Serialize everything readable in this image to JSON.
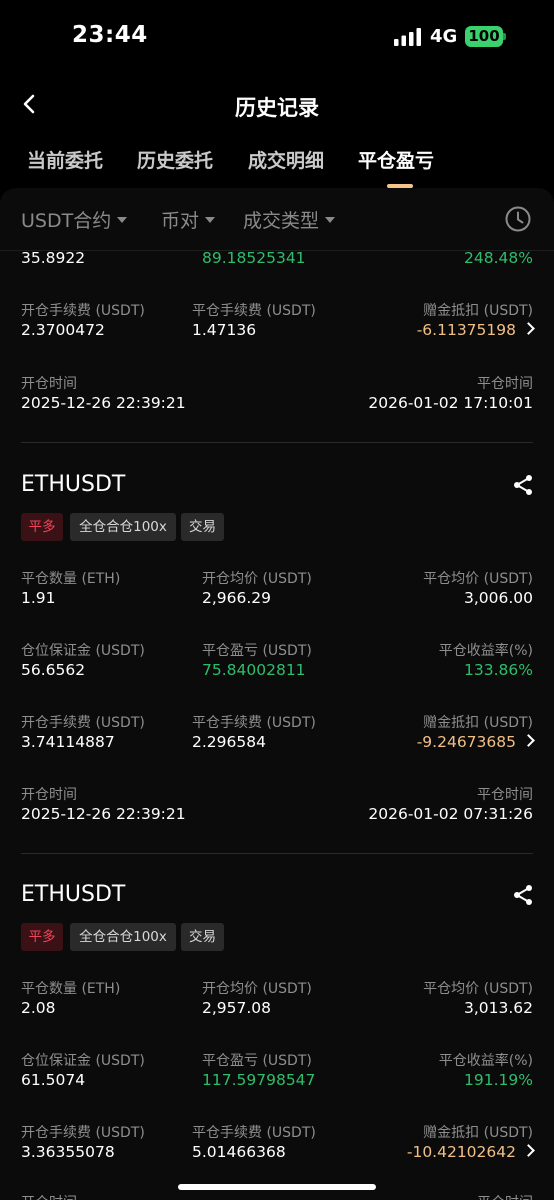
{
  "status": {
    "time": "23:44",
    "network": "4G",
    "battery": "100"
  },
  "nav": {
    "title": "历史记录"
  },
  "tabs": [
    {
      "label": "当前委托",
      "active": false
    },
    {
      "label": "历史委托",
      "active": false
    },
    {
      "label": "成交明细",
      "active": false
    },
    {
      "label": "平仓盈亏",
      "active": true
    }
  ],
  "filters": {
    "contract": "USDT合约",
    "pair": "币对",
    "type": "成交类型"
  },
  "card0": {
    "row1": {
      "v1": "35.8922",
      "v2": "89.18525341",
      "v3": "248.48%"
    },
    "row2": {
      "l1": "开仓手续费 (USDT)",
      "v1": "2.3700472",
      "l2": "平仓手续费 (USDT)",
      "v2": "1.47136",
      "l3": "赠金抵扣 (USDT)",
      "v3": "-6.11375198"
    },
    "row3": {
      "l1": "开仓时间",
      "v1": "2025-12-26 22:39:21",
      "l3": "平仓时间",
      "v3": "2026-01-02 17:10:01"
    }
  },
  "card1": {
    "symbol": "ETHUSDT",
    "tags": [
      "平多",
      "全仓合仓100x",
      "交易"
    ],
    "row1": {
      "l1": "平仓数量 (ETH)",
      "v1": "1.91",
      "l2": "开仓均价 (USDT)",
      "v2": "2,966.29",
      "l3": "平仓均价 (USDT)",
      "v3": "3,006.00"
    },
    "row2": {
      "l1": "仓位保证金 (USDT)",
      "v1": "56.6562",
      "l2": "平仓盈亏 (USDT)",
      "v2": "75.84002811",
      "l3": "平仓收益率(%)",
      "v3": "133.86%"
    },
    "row3": {
      "l1": "开仓手续费 (USDT)",
      "v1": "3.74114887",
      "l2": "平仓手续费 (USDT)",
      "v2": "2.296584",
      "l3": "赠金抵扣 (USDT)",
      "v3": "-9.24673685"
    },
    "row4": {
      "l1": "开仓时间",
      "v1": "2025-12-26 22:39:21",
      "l3": "平仓时间",
      "v3": "2026-01-02 07:31:26"
    }
  },
  "card2": {
    "symbol": "ETHUSDT",
    "tags": [
      "平多",
      "全仓合仓100x",
      "交易"
    ],
    "row1": {
      "l1": "平仓数量 (ETH)",
      "v1": "2.08",
      "l2": "开仓均价 (USDT)",
      "v2": "2,957.08",
      "l3": "平仓均价 (USDT)",
      "v3": "3,013.62"
    },
    "row2": {
      "l1": "仓位保证金 (USDT)",
      "v1": "61.5074",
      "l2": "平仓盈亏 (USDT)",
      "v2": "117.59798547",
      "l3": "平仓收益率(%)",
      "v3": "191.19%"
    },
    "row3": {
      "l1": "开仓手续费 (USDT)",
      "v1": "3.36355078",
      "l2": "平仓手续费 (USDT)",
      "v2": "5.01466368",
      "l3": "赠金抵扣 (USDT)",
      "v3": "-10.42102642"
    },
    "row4": {
      "l1": "开仓时间",
      "l3": "平仓时间"
    }
  },
  "colors": {
    "green": "#2ebd6b",
    "orange": "#f1c087",
    "red": "#f0445b",
    "accent": "#f5c48a"
  }
}
